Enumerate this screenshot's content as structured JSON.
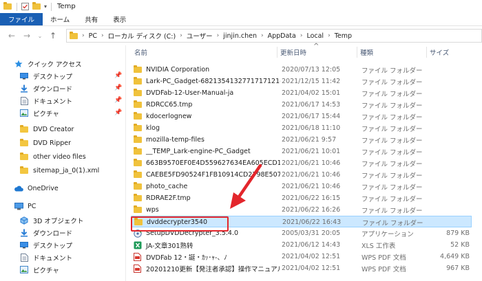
{
  "window": {
    "title": "Temp"
  },
  "ribbon": {
    "tabs": [
      "ファイル",
      "ホーム",
      "共有",
      "表示"
    ]
  },
  "address": {
    "segments": [
      "PC",
      "ローカル ディスク (C:)",
      "ユーザー",
      "jinjin.chen",
      "AppData",
      "Local",
      "Temp"
    ]
  },
  "columns": {
    "name": "名前",
    "date": "更新日時",
    "type": "種類",
    "size": "サイズ"
  },
  "nav": {
    "quick_access": "クイック アクセス",
    "items": [
      {
        "label": "デスクトップ",
        "icon": "desktop-icon",
        "pinned": true
      },
      {
        "label": "ダウンロード",
        "icon": "download-icon",
        "pinned": true
      },
      {
        "label": "ドキュメント",
        "icon": "document-icon",
        "pinned": true
      },
      {
        "label": "ピクチャ",
        "icon": "picture-icon",
        "pinned": true
      },
      {
        "label": "DVD Creator",
        "icon": "folder-icon",
        "pinned": false
      },
      {
        "label": "DVD Ripper",
        "icon": "folder-icon",
        "pinned": false
      },
      {
        "label": "other video files",
        "icon": "folder-icon",
        "pinned": false
      },
      {
        "label": "sitemap_ja_0(1).xml",
        "icon": "folder-icon",
        "pinned": false
      }
    ],
    "onedrive": "OneDrive",
    "pc": "PC",
    "pc_items": [
      {
        "label": "3D オブジェクト",
        "icon": "3d-objects-icon"
      },
      {
        "label": "ダウンロード",
        "icon": "download-icon"
      },
      {
        "label": "デスクトップ",
        "icon": "desktop-icon"
      },
      {
        "label": "ドキュメント",
        "icon": "document-icon"
      },
      {
        "label": "ピクチャ",
        "icon": "picture-icon"
      }
    ]
  },
  "files": [
    {
      "name": "NVIDIA Corporation",
      "date": "2020/07/13 12:05",
      "type": "ファイル フォルダー",
      "size": "",
      "icon": "folder-icon"
    },
    {
      "name": "Lark-PC_Gadget-6821354132771717121-cl...",
      "date": "2021/12/15 11:42",
      "type": "ファイル フォルダー",
      "size": "",
      "icon": "folder-icon"
    },
    {
      "name": "DVDFab-12-User-Manual-ja",
      "date": "2021/04/02 15:01",
      "type": "ファイル フォルダー",
      "size": "",
      "icon": "folder-icon"
    },
    {
      "name": "RDRCC65.tmp",
      "date": "2021/06/17 14:53",
      "type": "ファイル フォルダー",
      "size": "",
      "icon": "folder-icon"
    },
    {
      "name": "kdocerlognew",
      "date": "2021/06/17 15:44",
      "type": "ファイル フォルダー",
      "size": "",
      "icon": "folder-icon"
    },
    {
      "name": "klog",
      "date": "2021/06/18 11:10",
      "type": "ファイル フォルダー",
      "size": "",
      "icon": "folder-icon"
    },
    {
      "name": "mozilla-temp-files",
      "date": "2021/06/21 9:57",
      "type": "ファイル フォルダー",
      "size": "",
      "icon": "folder-icon"
    },
    {
      "name": "__TEMP_Lark-engine-PC_Gadget",
      "date": "2021/06/21 10:01",
      "type": "ファイル フォルダー",
      "size": "",
      "icon": "folder-icon"
    },
    {
      "name": "663B9570EF0E4D559627634EA605ECD1",
      "date": "2021/06/21 10:46",
      "type": "ファイル フォルダー",
      "size": "",
      "icon": "folder-icon"
    },
    {
      "name": "CAEBE5FD90524F1FB10914CD2798E507",
      "date": "2021/06/21 10:46",
      "type": "ファイル フォルダー",
      "size": "",
      "icon": "folder-icon"
    },
    {
      "name": "photo_cache",
      "date": "2021/06/21 10:46",
      "type": "ファイル フォルダー",
      "size": "",
      "icon": "folder-icon"
    },
    {
      "name": "RDRAE2F.tmp",
      "date": "2021/06/22 16:15",
      "type": "ファイル フォルダー",
      "size": "",
      "icon": "folder-icon"
    },
    {
      "name": "wps",
      "date": "2021/06/22 16:26",
      "type": "ファイル フォルダー",
      "size": "",
      "icon": "folder-icon"
    },
    {
      "name": "dvddecrypter3540",
      "date": "2021/06/22 16:43",
      "type": "ファイル フォルダー",
      "size": "",
      "icon": "folder-icon",
      "selected": true
    },
    {
      "name": "SetupDVDDecrypter_3.5.4.0",
      "date": "2005/03/31 20:05",
      "type": "アプリケーション",
      "size": "879 KB",
      "icon": "installer-icon"
    },
    {
      "name": "JA-文章301熟转",
      "date": "2021/06/12 14:43",
      "type": "XLS 工作表",
      "size": "52 KB",
      "icon": "excel-icon"
    },
    {
      "name": "DVDFab 12・誕・ｶｯ･ｬ-、ﾉ",
      "date": "2021/04/02 12:51",
      "type": "WPS PDF 文档",
      "size": "4,649 KB",
      "icon": "pdf-icon"
    },
    {
      "name": "20201210更新【発注者承認】操作マニュアル",
      "date": "2021/04/02 12:51",
      "type": "WPS PDF 文档",
      "size": "967 KB",
      "icon": "pdf-icon"
    }
  ],
  "colors": {
    "accent": "#1a5fb4",
    "selection": "#cce8ff",
    "annotation": "#e3262c"
  }
}
